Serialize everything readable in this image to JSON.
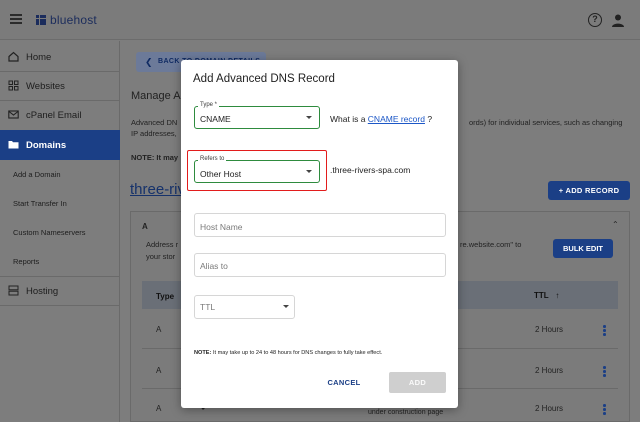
{
  "header": {
    "brand": "bluehost",
    "help_glyph": "?"
  },
  "sidebar": {
    "items": [
      {
        "label": "Home",
        "icon": "home-icon"
      },
      {
        "label": "Websites",
        "icon": "websites-grid-icon"
      },
      {
        "label": "cPanel Email",
        "icon": "email-icon"
      },
      {
        "label": "Domains",
        "icon": "folder-icon",
        "active": true
      },
      {
        "label": "Hosting",
        "icon": "server-icon"
      }
    ],
    "sub_items": [
      "Add a Domain",
      "Start Transfer In",
      "Custom Nameservers",
      "Reports"
    ]
  },
  "background": {
    "back_label": "BACK TO DOMAIN DETAILS",
    "title": "Manage Ac",
    "para_line1": "Advanced DN",
    "para_line2": "IP addresses,",
    "para_right": "ords) for individual services, such as changing",
    "note": "NOTE: It may",
    "domain": "three-rive",
    "add_record": "+ ADD RECORD",
    "card_title": "A",
    "card_text1": "Address r",
    "card_text2": "your stor",
    "card_text3": "re.website.com\" to",
    "bulk_edit": "BULK EDIT",
    "col_type": "Type",
    "col_ttl": "TTL",
    "sort_glyph": "↑",
    "rows": [
      {
        "type": "A",
        "ttl": "2 Hours"
      },
      {
        "type": "A",
        "ttl": "2 Hours"
      },
      {
        "type": "A",
        "ttl": "2 Hours"
      }
    ],
    "row_extra": "under construction page"
  },
  "modal": {
    "title": "Add Advanced DNS Record",
    "type_label": "Type *",
    "type_value": "CNAME",
    "cname_question_prefix": "What is a ",
    "cname_link": "CNAME record",
    "cname_question_suffix": " ?",
    "refers_label": "Refers to",
    "refers_value": "Other Host",
    "domain_suffix": ".three-rivers-spa.com",
    "host_name_placeholder": "Host Name",
    "alias_placeholder": "Alias to",
    "ttl_placeholder": "TTL",
    "note_bold": "NOTE:",
    "note_text": " It may take up to 24 to 48 hours for DNS changes to fully take effect.",
    "cancel_label": "CANCEL",
    "add_label": "ADD"
  },
  "colors": {
    "brand_blue": "#1b3f86",
    "focus_green": "#2e8b3e",
    "highlight_red": "#e21c1c",
    "link_blue": "#1c57c7"
  }
}
